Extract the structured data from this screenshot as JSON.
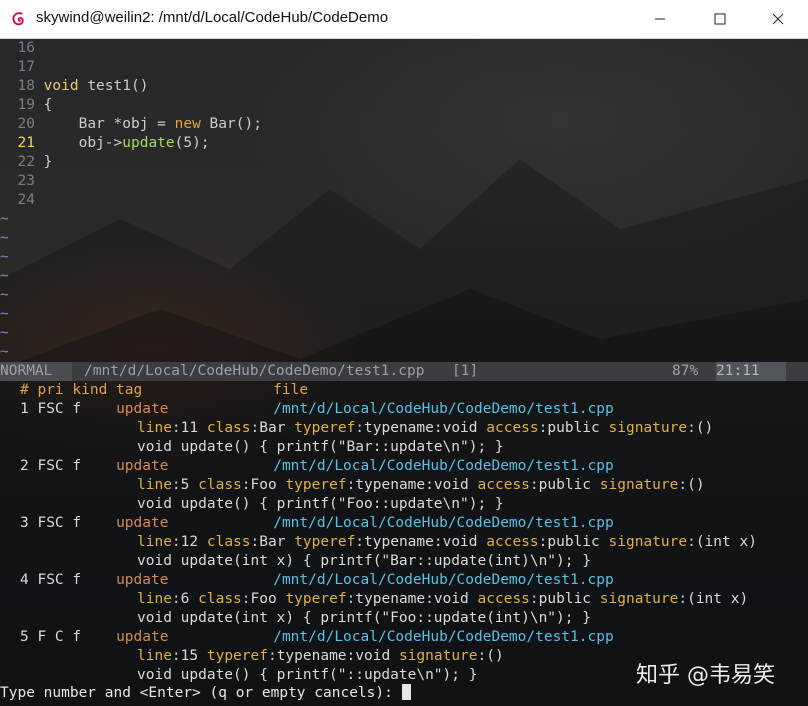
{
  "window": {
    "title": "skywind@weilin2: /mnt/d/Local/CodeHub/CodeDemo",
    "controls": {
      "minimize": "—",
      "maximize": "☐",
      "close": "✕"
    }
  },
  "editor": {
    "lines": [
      {
        "num": "16",
        "code": ""
      },
      {
        "num": "17",
        "code": ""
      },
      {
        "num": "18",
        "kw": "void",
        "rest": " test1()"
      },
      {
        "num": "19",
        "code": "{"
      },
      {
        "num": "20",
        "pre": "    Bar *obj = ",
        "kw": "new",
        "rest": " Bar();"
      },
      {
        "num": "21",
        "pre": "    obj->",
        "fn": "update",
        "rest": "(5);",
        "current": true
      },
      {
        "num": "22",
        "code": "}"
      },
      {
        "num": "23",
        "code": ""
      },
      {
        "num": "24",
        "code": ""
      }
    ],
    "tilde": "~",
    "tilde_rows": 8
  },
  "status": {
    "mode": "NORMAL",
    "file": "/mnt/d/Local/CodeHub/CodeDemo/test1.cpp",
    "buffer": "[1]",
    "percent": "87%",
    "position": "21:11"
  },
  "results": {
    "header": "# pri kind tag               file",
    "items": [
      {
        "idx": "1",
        "pri": "FSC",
        "kind": "f",
        "tag": "update",
        "file": "/mnt/d/Local/CodeHub/CodeDemo/test1.cpp",
        "fields": [
          {
            "k": "line",
            "v": "11"
          },
          {
            "k": "class",
            "v": "Bar"
          },
          {
            "k": "typeref",
            "v": "typename:void"
          },
          {
            "k": "access",
            "v": "public"
          },
          {
            "k": "signature",
            "v": "()"
          }
        ],
        "code": "void update() { printf(\"Bar::update\\n\"); }"
      },
      {
        "idx": "2",
        "pri": "FSC",
        "kind": "f",
        "tag": "update",
        "file": "/mnt/d/Local/CodeHub/CodeDemo/test1.cpp",
        "fields": [
          {
            "k": "line",
            "v": "5"
          },
          {
            "k": "class",
            "v": "Foo"
          },
          {
            "k": "typeref",
            "v": "typename:void"
          },
          {
            "k": "access",
            "v": "public"
          },
          {
            "k": "signature",
            "v": "()"
          }
        ],
        "code": "void update() { printf(\"Foo::update\\n\"); }"
      },
      {
        "idx": "3",
        "pri": "FSC",
        "kind": "f",
        "tag": "update",
        "file": "/mnt/d/Local/CodeHub/CodeDemo/test1.cpp",
        "fields": [
          {
            "k": "line",
            "v": "12"
          },
          {
            "k": "class",
            "v": "Bar"
          },
          {
            "k": "typeref",
            "v": "typename:void"
          },
          {
            "k": "access",
            "v": "public"
          },
          {
            "k": "signature",
            "v": "(int x)"
          }
        ],
        "code": "void update(int x) { printf(\"Bar::update(int)\\n\"); }"
      },
      {
        "idx": "4",
        "pri": "FSC",
        "kind": "f",
        "tag": "update",
        "file": "/mnt/d/Local/CodeHub/CodeDemo/test1.cpp",
        "fields": [
          {
            "k": "line",
            "v": "6"
          },
          {
            "k": "class",
            "v": "Foo"
          },
          {
            "k": "typeref",
            "v": "typename:void"
          },
          {
            "k": "access",
            "v": "public"
          },
          {
            "k": "signature",
            "v": "(int x)"
          }
        ],
        "code": "void update(int x) { printf(\"Foo::update(int)\\n\"); }"
      },
      {
        "idx": "5",
        "pri": "F C",
        "kind": "f",
        "tag": "update",
        "file": "/mnt/d/Local/CodeHub/CodeDemo/test1.cpp",
        "fields": [
          {
            "k": "line",
            "v": "15"
          },
          {
            "k": "typeref",
            "v": "typename:void"
          },
          {
            "k": "signature",
            "v": "()"
          }
        ],
        "code": "void update() { printf(\"::update\\n\"); }"
      }
    ]
  },
  "prompt": "Type number and <Enter> (q or empty cancels): ",
  "watermark": "知乎 @韦易笑"
}
